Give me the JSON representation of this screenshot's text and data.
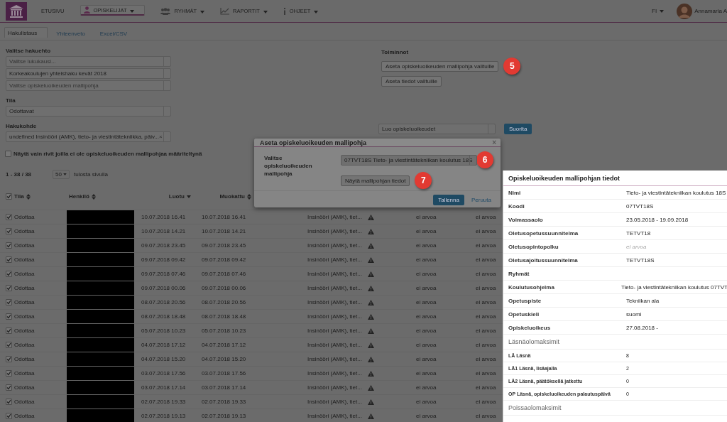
{
  "nav": {
    "items": [
      {
        "label": "ETUSIVU",
        "selected": false
      },
      {
        "label": "OPISKELIJAT",
        "selected": true
      },
      {
        "label": "RYHMÄT",
        "selected": false
      },
      {
        "label": "RAPORTIT",
        "selected": false
      },
      {
        "label": "OHJEET",
        "selected": false
      }
    ],
    "language": "FI",
    "user": "Annamaria A"
  },
  "tabs": [
    {
      "label": "Hakulistaus",
      "selected": true
    },
    {
      "label": "Yhteenveto",
      "selected": false
    },
    {
      "label": "Excel/CSV",
      "selected": false
    }
  ],
  "filters": {
    "heading": "Valitse hakuehto",
    "selects": [
      {
        "placeholder": "Valitse lukukausi..."
      },
      {
        "value": "Korkeakoulujen yhteishaku kevät 2018"
      },
      {
        "placeholder": "Valitse opiskeluoikeuden mallipohja"
      }
    ],
    "state": {
      "label": "Tila",
      "value": "Odottavat"
    },
    "target": {
      "label": "Hakukohde",
      "value": "undefined Insinööri (AMK), tieto- ja viestintätekniikka, päiv...",
      "clear": "×"
    },
    "only_missing": {
      "label": "Näytä vain rivit joilla ei ole opiskeluoikeuden mallipohjaa määriteltynä",
      "checked": false
    }
  },
  "actions": {
    "heading": "Toiminnot",
    "buttons": [
      {
        "label": "Aseta opiskeluoikeuden mallipohja valituille",
        "callout": "5"
      },
      {
        "label": "Aseta tiedot valituille"
      }
    ],
    "select": "Luo opiskeluoikeudet",
    "run": "Suorita"
  },
  "pagination": {
    "range": "1 - 38 / 38",
    "page_size": "50",
    "suffix": "tulosta sivulla"
  },
  "table": {
    "all_checked": true,
    "columns": [
      {
        "label": "Tila"
      },
      {
        "label": "Henkilö"
      },
      {
        "label": "Luotu"
      },
      {
        "label": "Muokattu"
      }
    ],
    "rows": [
      {
        "checked": true,
        "state": "Odottaa",
        "created": "10.07.2018 16.41",
        "modified": "10.07.2018 16.41",
        "target": "Insinööri (AMK), tiet...",
        "warning": true,
        "column_7": "ei arvoa",
        "column_8": "ei arvoa"
      },
      {
        "checked": true,
        "state": "Odottaa",
        "created": "10.07.2018 14.21",
        "modified": "10.07.2018 14.21",
        "target": "Insinööri (AMK), tiet...",
        "warning": true,
        "column_7": "ei arvoa",
        "column_8": "ei arvoa"
      },
      {
        "checked": true,
        "state": "Odottaa",
        "created": "09.07.2018 23.45",
        "modified": "09.07.2018 23.45",
        "target": "Insinööri (AMK), tiet...",
        "warning": true,
        "column_7": "ei arvoa",
        "column_8": "ei arvoa"
      },
      {
        "checked": true,
        "state": "Odottaa",
        "created": "09.07.2018 09.42",
        "modified": "09.07.2018 09.42",
        "target": "Insinööri (AMK), tiet...",
        "warning": true,
        "column_7": "ei arvoa",
        "column_8": "ei arvoa"
      },
      {
        "checked": true,
        "state": "Odottaa",
        "created": "09.07.2018 07.46",
        "modified": "09.07.2018 07.46",
        "target": "Insinööri (AMK), tiet...",
        "warning": true,
        "column_7": "ei arvoa",
        "column_8": "ei arvoa"
      },
      {
        "checked": true,
        "state": "Odottaa",
        "created": "09.07.2018 00.06",
        "modified": "09.07.2018 00.06",
        "target": "Insinööri (AMK), tiet...",
        "warning": true,
        "column_7": "ei arvoa",
        "column_8": "ei arvoa"
      },
      {
        "checked": true,
        "state": "Odottaa",
        "created": "08.07.2018 20.56",
        "modified": "08.07.2018 20.56",
        "target": "Insinööri (AMK), tiet...",
        "warning": true,
        "column_7": "ei arvoa",
        "column_8": "ei arvoa"
      },
      {
        "checked": true,
        "state": "Odottaa",
        "created": "08.07.2018 18.48",
        "modified": "08.07.2018 18.48",
        "target": "Insinööri (AMK), tiet...",
        "warning": true,
        "column_7": "ei arvoa",
        "column_8": "ei arvoa"
      },
      {
        "checked": true,
        "state": "Odottaa",
        "created": "05.07.2018 10.23",
        "modified": "05.07.2018 10.23",
        "target": "Insinööri (AMK), tiet...",
        "warning": true,
        "column_7": "ei arvoa",
        "column_8": "ei arvoa"
      },
      {
        "checked": true,
        "state": "Odottaa",
        "created": "04.07.2018 17.12",
        "modified": "04.07.2018 17.12",
        "target": "Insinööri (AMK), tiet...",
        "warning": true,
        "column_7": "ei arvoa",
        "column_8": "ei arvoa"
      },
      {
        "checked": true,
        "state": "Odottaa",
        "created": "04.07.2018 15.20",
        "modified": "04.07.2018 15.20",
        "target": "Insinööri (AMK), tiet...",
        "warning": true,
        "column_7": "ei arvoa",
        "column_8": "ei arvoa"
      },
      {
        "checked": true,
        "state": "Odottaa",
        "created": "03.07.2018 17.56",
        "modified": "03.07.2018 17.56",
        "target": "Insinööri (AMK), tiet...",
        "warning": true,
        "column_7": "ei arvoa",
        "column_8": "ei arvoa"
      },
      {
        "checked": true,
        "state": "Odottaa",
        "created": "03.07.2018 17.14",
        "modified": "03.07.2018 17.14",
        "target": "Insinööri (AMK), tiet...",
        "warning": true,
        "column_7": "ei arvoa",
        "column_8": "ei arvoa"
      },
      {
        "checked": true,
        "state": "Odottaa",
        "created": "02.07.2018 19.33",
        "modified": "02.07.2018 19.33",
        "target": "Insinööri (AMK), tiet...",
        "warning": true,
        "column_7": "ei arvoa",
        "column_8": "ei arvoa"
      },
      {
        "checked": true,
        "state": "Odottaa",
        "created": "02.07.2018 19.13",
        "modified": "02.07.2018 19.13",
        "target": "Insinööri (AMK), tiet...",
        "warning": true,
        "column_7": "ei arvoa",
        "column_8": "ei arvoa"
      }
    ]
  },
  "dialog": {
    "title": "Aseta opiskeluoikeuden mallipohja",
    "close": "×",
    "field_label": "Valitse opiskeluoikeuden mallipohja",
    "value": "07TVT18S Tieto- ja viestintätekniikan koulutus 18S",
    "value_callout": "6",
    "details_button": "Näytä mallipohjan tiedot",
    "details_callout": "7",
    "save": "Tallenna",
    "cancel": "Peruuta"
  },
  "details": {
    "title": "Opiskeluoikeuden mallipohjan tiedot",
    "items": [
      {
        "kind": "field",
        "label": "Nimi",
        "value": "Tieto- ja viestintätekniikan koulutus 18S"
      },
      {
        "kind": "field",
        "label": "Koodi",
        "value": "07TVT18S"
      },
      {
        "kind": "field",
        "label": "Voimassaolo",
        "value": "23.05.2018 - 19.09.2018"
      },
      {
        "kind": "field",
        "label": "Oletusopetussuunnitelma",
        "value": "TETVT18"
      },
      {
        "kind": "field",
        "label": "Oletusopintopolku",
        "no_value_note": "ei arvoa"
      },
      {
        "kind": "field",
        "label": "Oletusajoitussuunnitelma",
        "value": "TETVT18S"
      },
      {
        "kind": "field",
        "label": "Ryhmät"
      },
      {
        "kind": "field",
        "label": "Koulutusohjelma",
        "value": "Tieto- ja viestintätekniikan koulutus 07TVT"
      },
      {
        "kind": "field",
        "label": "Opetuspiste",
        "value": "Tekniikan ala"
      },
      {
        "kind": "field",
        "label": "Opetuskieli",
        "value": "suomi"
      },
      {
        "kind": "field",
        "label": "Opiskeluoikeus",
        "value": "27.08.2018 -"
      },
      {
        "kind": "section",
        "label": "Läsnäolomaksimit"
      },
      {
        "kind": "limit",
        "label": "LÄ Läsnä",
        "value": "8"
      },
      {
        "kind": "limit",
        "label": "LÄ1 Läsnä, lisäajalla",
        "value": "2"
      },
      {
        "kind": "limit",
        "label": "LÄ2 Läsnä, päätöksellä jatkettu",
        "value": "0"
      },
      {
        "kind": "limit",
        "label": "OP Läsnä, opiskeluoikeuden palautuspäivä",
        "value": "0"
      },
      {
        "kind": "section",
        "label": "Poissaolomaksimit"
      }
    ]
  }
}
